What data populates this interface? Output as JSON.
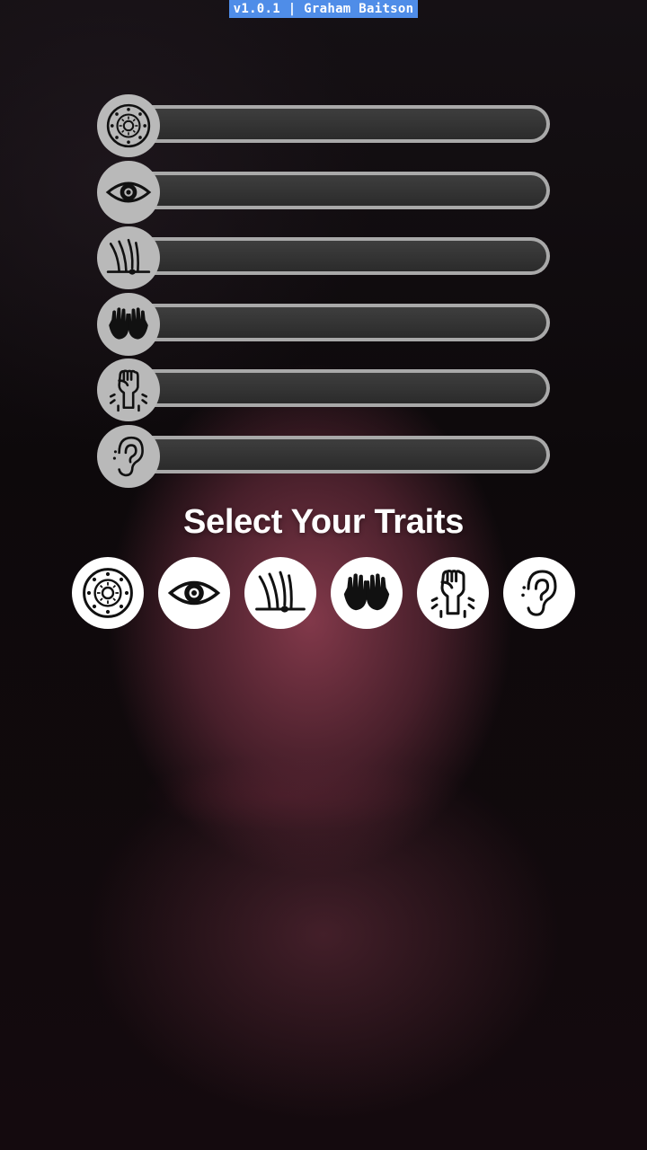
{
  "version_label": "v1.0.1 | Graham Baitson",
  "title": "Select Your Traits",
  "trait_bars": [
    {
      "icon": "zodiac-wheel-icon",
      "level": 0
    },
    {
      "icon": "eye-icon",
      "level": 0
    },
    {
      "icon": "hair-follicle-icon",
      "level": 0
    },
    {
      "icon": "hands-icon",
      "level": 0
    },
    {
      "icon": "raised-fist-icon",
      "level": 0
    },
    {
      "icon": "ear-icon",
      "level": 0
    }
  ],
  "trait_buttons": [
    {
      "icon": "zodiac-wheel-icon"
    },
    {
      "icon": "eye-icon"
    },
    {
      "icon": "hair-follicle-icon"
    },
    {
      "icon": "hands-icon"
    },
    {
      "icon": "raised-fist-icon"
    },
    {
      "icon": "ear-icon"
    }
  ],
  "colors": {
    "version_badge": "#4f8de8",
    "bar_track": "#a9a9a9",
    "bar_inner": "#333333",
    "icon_bg_bar": "#b9b9b9",
    "icon_bg_button": "#ffffff"
  }
}
